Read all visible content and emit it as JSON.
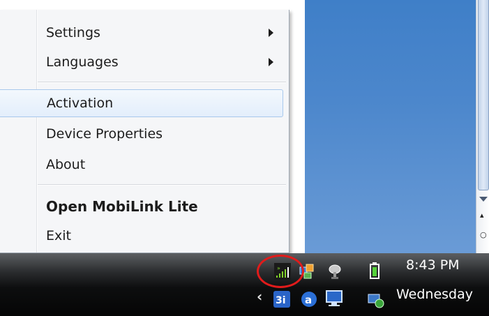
{
  "menu": {
    "items": [
      {
        "label": "Settings",
        "has_submenu": true
      },
      {
        "label": "Languages",
        "has_submenu": true
      },
      {
        "label": "Activation",
        "highlighted": true
      },
      {
        "label": "Device Properties"
      },
      {
        "label": "About"
      },
      {
        "label": "Open MobiLink Lite",
        "bold": true
      },
      {
        "label": "Exit"
      }
    ]
  },
  "taskbar": {
    "clock_time": "8:43 PM",
    "clock_day": "Wednesday",
    "tray_icons": [
      "mobilink-signal-icon",
      "network-connections-icon",
      "satellite-icon",
      "battery-icon",
      "app-icon-3d",
      "app-icon-a",
      "computer-icon",
      "network-globe-icon"
    ]
  },
  "colors": {
    "desktop_blue": "#4c87cc",
    "highlight_border": "#a8c8ec",
    "annotation_red": "#e01b1b"
  }
}
